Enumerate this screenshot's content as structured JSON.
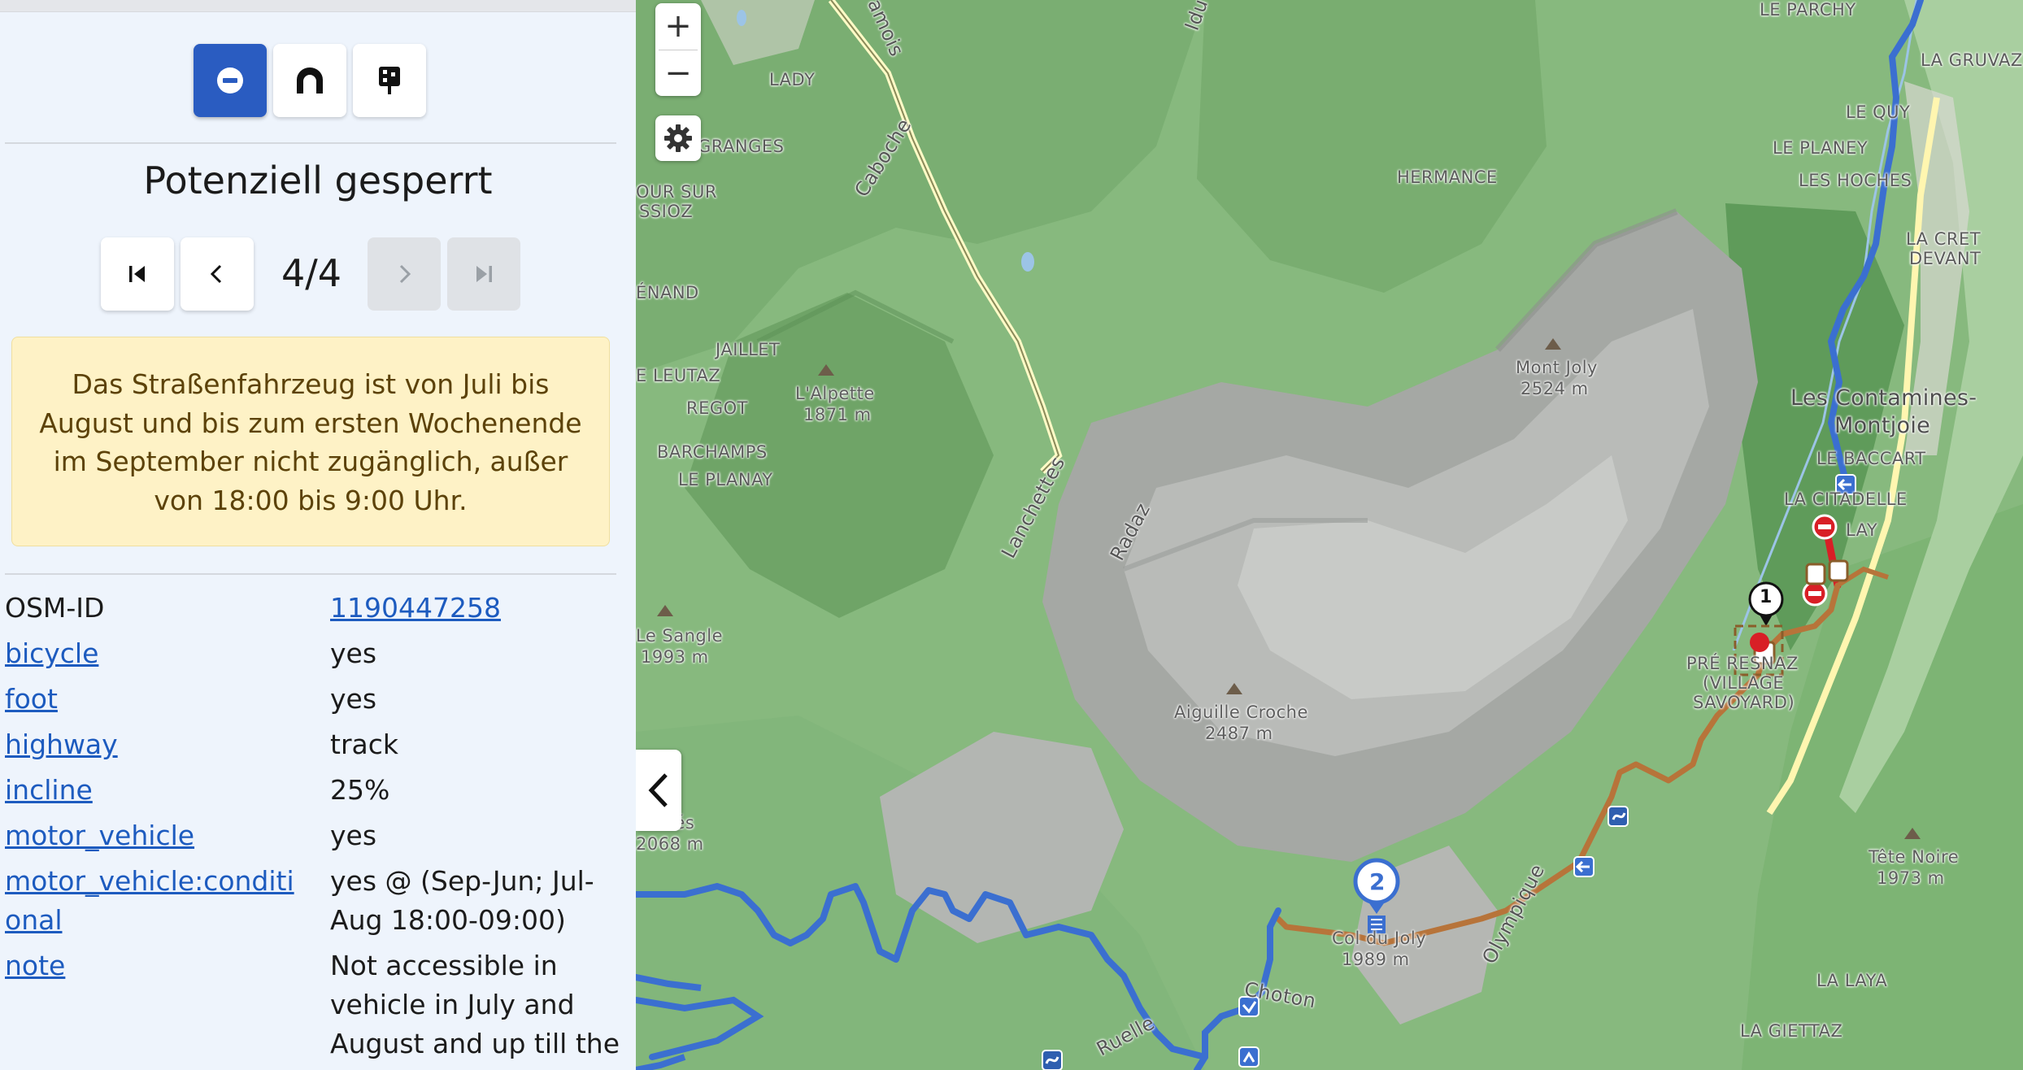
{
  "sidebar": {
    "toolbar": {
      "buttons": [
        {
          "name": "no-entry-icon",
          "active": true
        },
        {
          "name": "tunnel-icon",
          "active": false
        },
        {
          "name": "barrier-icon",
          "active": false
        }
      ]
    },
    "title": "Potenziell gesperrt",
    "pager": {
      "counter": "4/4"
    },
    "note": "Das Straßenfahrzeug ist von Juli bis August und bis zum ersten Wochenende im September nicht zugänglich, außer von 18:00 bis 9:00 Uhr.",
    "tags": [
      {
        "key": "OSM-ID",
        "value": "1190447258",
        "key_link": false,
        "value_link": true
      },
      {
        "key": "bicycle",
        "value": "yes",
        "key_link": true,
        "value_link": false
      },
      {
        "key": "foot",
        "value": "yes",
        "key_link": true,
        "value_link": false
      },
      {
        "key": "highway",
        "value": "track",
        "key_link": true,
        "value_link": false
      },
      {
        "key": "incline",
        "value": "25%",
        "key_link": true,
        "value_link": false
      },
      {
        "key": "motor_vehicle",
        "value": "yes",
        "key_link": true,
        "value_link": false
      },
      {
        "key": "motor_vehicle:conditi\nonal",
        "value": "yes @ (Sep-Jun; Jul-\nAug 18:00-09:00)",
        "key_link": true,
        "value_link": false
      },
      {
        "key": "note",
        "value": "Not accessible in\nvehicle in July and\nAugust and up till the",
        "key_link": true,
        "value_link": false
      }
    ]
  },
  "map": {
    "controls": {
      "zoom_in": "+",
      "zoom_out": "−"
    },
    "labels": {
      "le_parchy": "LE PARCHY",
      "la_gruvaz": "LA GRUVAZ",
      "le_quy": "LE QUY",
      "le_planey": "LE PLANEY",
      "les_hoches": "LES HOCHES",
      "la_cret_devant_1": "LA CRET",
      "la_cret_devant_2": "DEVANT",
      "lady": "LADY",
      "granges": "GRANGES",
      "caboche": "Caboche",
      "hermance": "HERMANCE",
      "sur_1": "OUR SUR",
      "sur_2": "SSIOZ",
      "enand": "ÉNAND",
      "jaillet": "JAILLET",
      "leutaz": "E LEUTAZ",
      "regot": "REGOT",
      "barchamps": "BARCHAMPS",
      "le_planay": "LE PLANAY",
      "alpette": "L'Alpette",
      "alpette_h": "1871 m",
      "mont_joly": "Mont Joly",
      "mont_joly_h": "2524 m",
      "contamines_1": "Les Contamines-",
      "contamines_2": "Montjoie",
      "le_baccart": "LE BACCART",
      "la_citadelle": "LA CITADELLE",
      "lay": "LAY",
      "pre": "PRÉ RESNAZ",
      "village_1": "(VILLAGE",
      "village_2": "SAVOYARD)",
      "lanchettes": "Lanchettes",
      "radaz": "Radaz",
      "sangle": "Le Sangle",
      "sangle_h": "1993 m",
      "croche": "Aiguille Croche",
      "croche_h": "2487 m",
      "pres": "Prés",
      "pres_h": "2068 m",
      "col": "Col du Joly",
      "col_h": "1989 m",
      "olympique": "Olympique",
      "tete_noire": "Tête Noire",
      "tete_noire_h": "1973 m",
      "la_laya": "LA LAYA",
      "la_giettaz": "LA GIETTAZ",
      "choton": "Choton",
      "ruelle": "Ruelle",
      "idu": "Idu",
      "amois": "amois",
      "marker_1": "1",
      "marker_2": "2"
    }
  },
  "colors": {
    "accent": "#2a5cc1",
    "route_blue": "#3b6fd0",
    "track_brown": "#b7743a",
    "closure_red": "#d81f26",
    "note_bg": "#fef2c6"
  }
}
